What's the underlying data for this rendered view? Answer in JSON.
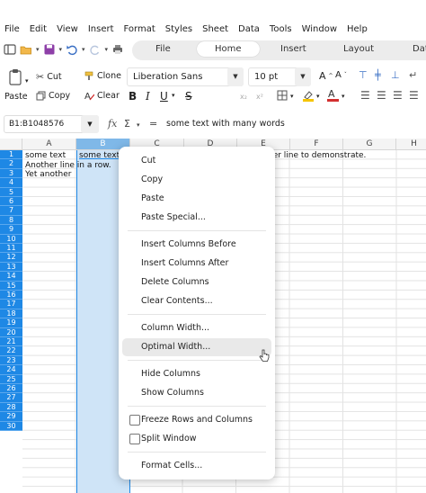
{
  "menubar": [
    "File",
    "Edit",
    "View",
    "Insert",
    "Format",
    "Styles",
    "Sheet",
    "Data",
    "Tools",
    "Window",
    "Help"
  ],
  "tabs": {
    "items": [
      "File",
      "Home",
      "Insert",
      "Layout",
      "Dat"
    ],
    "active": "Home"
  },
  "ribbon": {
    "paste_label": "Paste",
    "cut_label": "Cut",
    "copy_label": "Copy",
    "clone_label": "Clone",
    "clear_label": "Clear",
    "font_name": "Liberation Sans",
    "font_size": "10 pt",
    "bold": "B",
    "italic": "I",
    "underline": "U",
    "strike": "S"
  },
  "formula_bar": {
    "name_box": "B1:B1048576",
    "fx": "fx",
    "sum": "Σ",
    "equals": "=",
    "content": "some text with many words"
  },
  "grid": {
    "columns": [
      "A",
      "B",
      "C",
      "D",
      "E",
      "F",
      "G",
      "H"
    ],
    "selected_column": "B",
    "rows": [
      "1",
      "2",
      "3",
      "4",
      "5",
      "6",
      "7",
      "8",
      "9",
      "10",
      "11",
      "12",
      "13",
      "14",
      "15",
      "16",
      "17",
      "18",
      "19",
      "20",
      "21",
      "22",
      "23",
      "24",
      "25",
      "26",
      "27",
      "28",
      "29",
      "30"
    ],
    "cells": {
      "A1": "some text",
      "B1": "some text",
      "E1_overflow": "her line to demonstrate.",
      "A2": "Another line in a row.",
      "A3": "Yet another"
    }
  },
  "context_menu": {
    "items": [
      {
        "label": "Cut"
      },
      {
        "label": "Copy"
      },
      {
        "label": "Paste"
      },
      {
        "label": "Paste Special..."
      },
      {
        "label": "Insert Columns Before"
      },
      {
        "label": "Insert Columns After"
      },
      {
        "label": "Delete Columns"
      },
      {
        "label": "Clear Contents..."
      },
      {
        "label": "Column Width..."
      },
      {
        "label": "Optimal Width..."
      },
      {
        "label": "Hide Columns"
      },
      {
        "label": "Show Columns"
      },
      {
        "label": "Freeze Rows and Columns"
      },
      {
        "label": "Split Window"
      },
      {
        "label": "Format Cells..."
      }
    ],
    "hovered": "Optimal Width..."
  },
  "colors": {
    "row_header": "#1e88e5",
    "selection_fill": "#cfe4f7",
    "font_color_accent": "#d32f2f",
    "highlight_accent": "#f5c400"
  }
}
